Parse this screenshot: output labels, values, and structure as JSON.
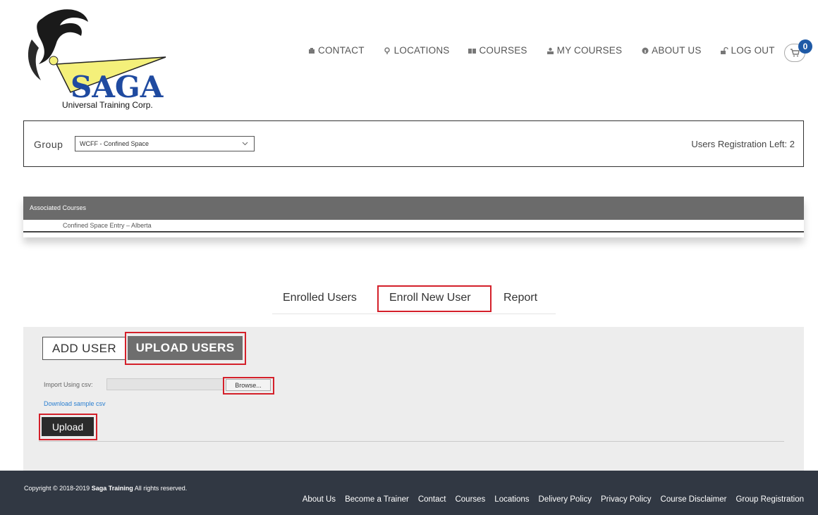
{
  "logo": {
    "brand": "SAGA",
    "caption": "Universal Training Corp."
  },
  "nav": {
    "items": [
      {
        "label": "CONTACT",
        "icon": "contact-icon"
      },
      {
        "label": "LOCATIONS",
        "icon": "location-pin-icon"
      },
      {
        "label": "COURSES",
        "icon": "book-icon"
      },
      {
        "label": "MY COURSES",
        "icon": "user-group-icon"
      },
      {
        "label": "ABOUT US",
        "icon": "info-icon"
      },
      {
        "label": "LOG OUT",
        "icon": "lock-icon"
      }
    ],
    "cart_count": "0"
  },
  "group": {
    "label": "Group",
    "selected": "WCFF - Confined Space",
    "registration_left": "Users Registration Left: 2"
  },
  "associated_courses": {
    "header": "Associated Courses",
    "rows": [
      "Confined Space Entry – Alberta"
    ]
  },
  "tabs": {
    "enrolled": "Enrolled Users",
    "enroll_new": "Enroll New User",
    "report": "Report"
  },
  "panel": {
    "add_user": "ADD USER",
    "upload_users": "UPLOAD USERS",
    "import_label": "Import Using csv:",
    "browse": "Browse...",
    "sample_link": "Download sample csv",
    "upload_button": "Upload"
  },
  "footer": {
    "copyright_prefix": "Copyright © 2018-2019 ",
    "copyright_brand": "Saga Training",
    "copyright_suffix": " All rights reserved.",
    "links": [
      "About Us",
      "Become a Trainer",
      "Contact",
      "Courses",
      "Locations",
      "Delivery Policy",
      "Privacy Policy",
      "Course Disclaimer",
      "Group Registration"
    ]
  },
  "colors": {
    "highlight": "#d4202a",
    "footer_bg": "#313843",
    "badge": "#1f5aa6"
  }
}
